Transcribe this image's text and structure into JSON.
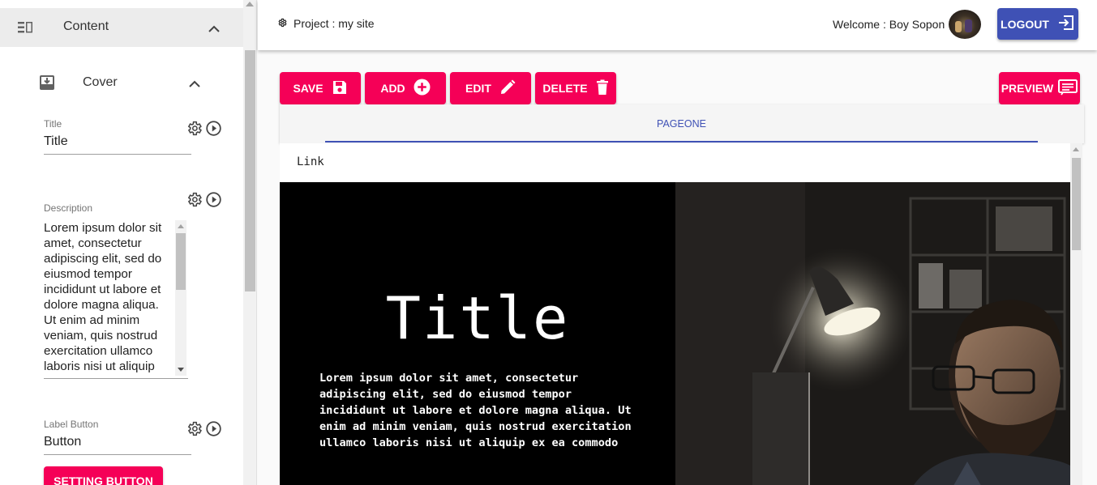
{
  "sidebar": {
    "section_label": "Content",
    "cover_label": "Cover",
    "title_field": {
      "label": "Title",
      "value": "Title"
    },
    "description_field": {
      "label": "Description",
      "value": "Lorem ipsum dolor sit amet, consectetur adipiscing elit, sed do eiusmod tempor incididunt ut labore et dolore magna aliqua. Ut enim ad minim veniam, quis nostrud exercitation ullamco laboris nisi ut aliquip"
    },
    "label_button_field": {
      "label": "Label Button",
      "value": "Button"
    },
    "setting_button_label": "SETTING BUTTON"
  },
  "header": {
    "project_text": "Project : my site",
    "welcome_text": "Welcome : Boy Sopon",
    "logout_label": "LOGOUT"
  },
  "toolbar": {
    "save_label": "SAVE",
    "add_label": "ADD",
    "edit_label": "EDIT",
    "delete_label": "DELETE",
    "preview_label": "PREVIEW"
  },
  "tabs": [
    {
      "label": "PAGEONE"
    }
  ],
  "preview": {
    "link_text": "Link",
    "hero_title": "Title",
    "hero_description": "Lorem ipsum dolor sit amet, consectetur adipiscing elit, sed do eiusmod tempor incididunt ut labore et dolore magna aliqua. Ut enim ad minim veniam, quis nostrud exercitation ullamco laboris nisi ut aliquip ex ea commodo"
  },
  "colors": {
    "accent": "#f50057",
    "primary": "#3f51b5"
  },
  "icons": [
    "view-list-icon",
    "chevron-up-icon",
    "inbox-download-icon",
    "gear-icon",
    "play-circle-icon",
    "save-icon",
    "add-circle-icon",
    "pencil-icon",
    "trash-icon",
    "logout-icon",
    "preview-icon",
    "settings-icon"
  ]
}
